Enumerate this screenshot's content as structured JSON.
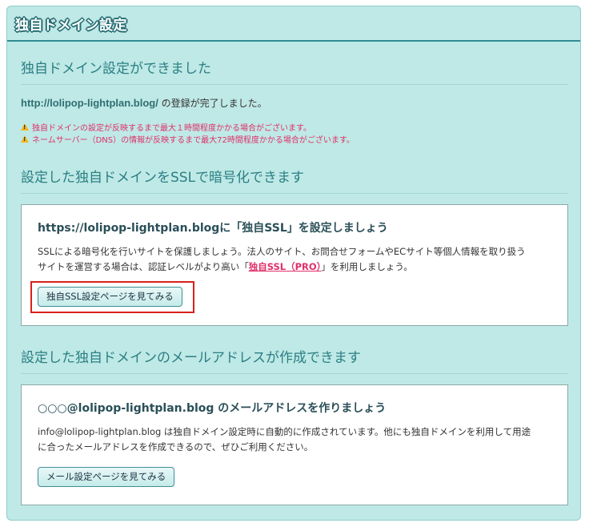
{
  "panel": {
    "title": "独自ドメイン設定"
  },
  "completion": {
    "heading": "独自ドメイン設定ができました",
    "domain_url": "http://lolipop-lightplan.blog/",
    "domain_suffix": " の登録が完了しました。",
    "warnings": [
      "独自ドメインの設定が反映するまで最大１時間程度かかる場合がございます。",
      "ネームサーバー（DNS）の情報が反映するまで最大72時間程度かかる場合がございます。"
    ]
  },
  "ssl": {
    "heading": "設定した独自ドメインをSSLで暗号化できます",
    "card_title": "https://lolipop-lightplan.blogに「独自SSL」を設定しましょう",
    "body_line1": "SSLによる暗号化を行いサイトを保護しましょう。法人のサイト、お問合せフォームやECサイト等個人情報を取り扱う",
    "body_line2_prefix": "サイトを運営する場合は、認証レベルがより高い「",
    "pro_link": "独自SSL（PRO）",
    "body_line2_suffix": "」を利用しましょう。",
    "button_label": "独自SSL設定ページを見てみる"
  },
  "mail": {
    "heading": "設定した独自ドメインのメールアドレスが作成できます",
    "card_title": "○○○@lolipop-lightplan.blog のメールアドレスを作りましょう",
    "body_line1": "info@lolipop-lightplan.blog は独自ドメイン設定時に自動的に作成されています。他にも独自ドメインを利用して用途",
    "body_line2": "に合ったメールアドレスを作成できるので、ぜひご利用ください。",
    "button_label": "メール設定ページを見てみる"
  },
  "colors": {
    "panel_bg": "#bfe9e6",
    "heading_teal": "#2b7f84",
    "warning_pink": "#e0306a",
    "highlight_red": "#d8201c"
  }
}
